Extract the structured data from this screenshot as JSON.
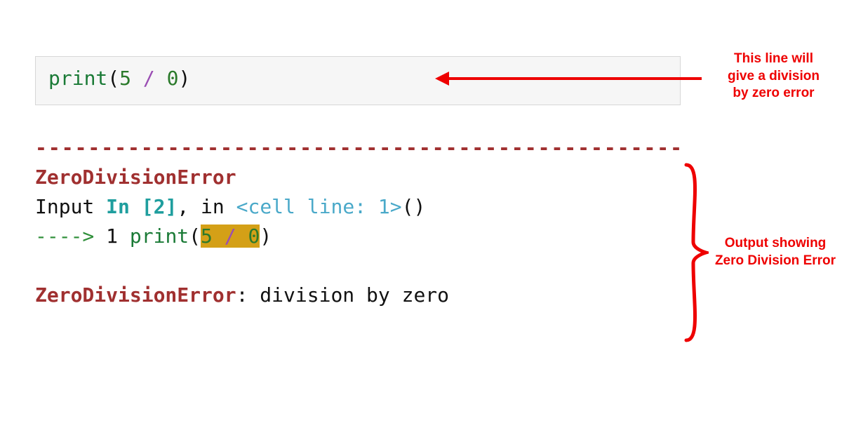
{
  "code_cell": {
    "func": "print",
    "lparen": "(",
    "num1": "5",
    "sp1": " ",
    "op": "/",
    "sp2": " ",
    "num2": "0",
    "rparen": ")"
  },
  "output": {
    "dashes": "-------------------------------------------------",
    "error_name": "ZeroDivisionError",
    "line2_input": "Input ",
    "line2_in": "In [2]",
    "line2_comma": ", in ",
    "line2_cell": "<cell line: 1>",
    "line2_parens": "()",
    "line3_arrow": "----> ",
    "line3_one": "1 ",
    "line3_func": "print",
    "line3_lparen": "(",
    "line3_hl1": "5",
    "line3_hl2": " / ",
    "line3_hl3": "0",
    "line3_rparen": ")",
    "final_err": "ZeroDivisionError",
    "final_colon": ": ",
    "final_msg": "division by zero"
  },
  "annotations": {
    "anno1_l1": "This line will",
    "anno1_l2": "give a division",
    "anno1_l3": "by zero error",
    "anno2_l1": "Output showing",
    "anno2_l2": "Zero Division Error"
  }
}
